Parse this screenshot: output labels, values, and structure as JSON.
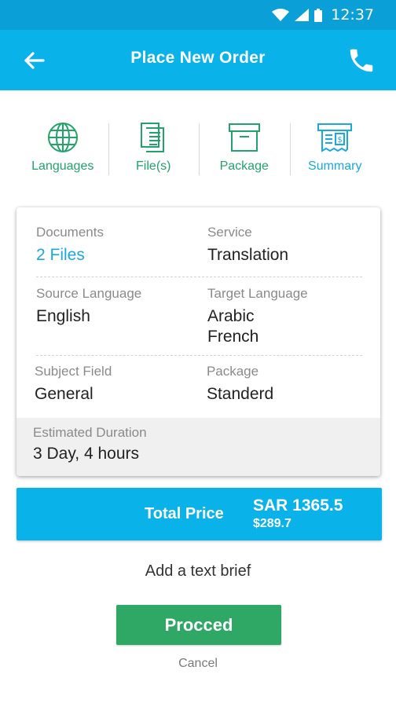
{
  "status_bar": {
    "time": "12:37",
    "icons": [
      "wifi-icon",
      "signal-icon",
      "battery-icon"
    ]
  },
  "header": {
    "title": "Place New Order",
    "back_icon": "arrow-left-icon",
    "call_icon": "phone-icon"
  },
  "steps": [
    {
      "label": "Languages",
      "icon": "globe-icon",
      "active": false
    },
    {
      "label": "File(s)",
      "icon": "files-icon",
      "active": false
    },
    {
      "label": "Package",
      "icon": "box-icon",
      "active": false
    },
    {
      "label": "Summary",
      "icon": "receipt-icon",
      "active": true
    }
  ],
  "summary": {
    "documents_label": "Documents",
    "documents_value": "2 Files",
    "service_label": "Service",
    "service_value": "Translation",
    "source_label": "Source Language",
    "source_value": "English",
    "target_label": "Target Language",
    "target_values": [
      "Arabic",
      "French"
    ],
    "subject_label": "Subject Field",
    "subject_value": "General",
    "package_label": "Package",
    "package_value": "Standerd",
    "duration_label": "Estimated Duration",
    "duration_value": "3 Day, 4 hours"
  },
  "total": {
    "label": "Total Price",
    "price_sar": "SAR 1365.5",
    "price_usd": "$289.7"
  },
  "brief_link": "Add a text brief",
  "proceed_label": "Procced",
  "cancel_label": "Cancel",
  "colors": {
    "primary": "#0ab2ea",
    "status_bar": "#0a9fd6",
    "green": "#2fa866",
    "step_green": "#23a26a",
    "step_active": "#1aa8df"
  }
}
